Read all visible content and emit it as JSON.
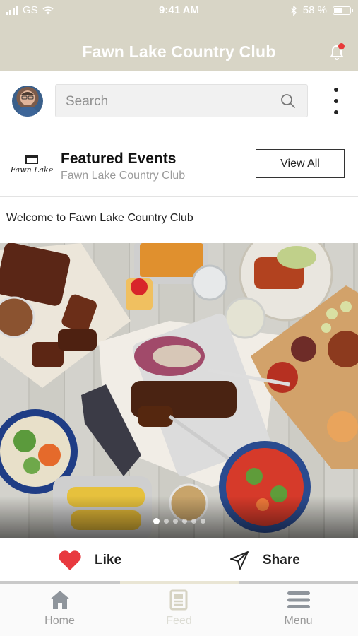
{
  "status_bar": {
    "carrier": "GS",
    "time": "9:41 AM",
    "battery": "58 %",
    "battery_level": 0.58
  },
  "header": {
    "title": "Fawn Lake Country Club",
    "notification_badge": true
  },
  "search": {
    "placeholder": "Search"
  },
  "featured": {
    "title": "Featured Events",
    "subtitle": "Fawn Lake Country Club",
    "view_all_label": "View All",
    "logo_text": "Fawn Lake"
  },
  "post": {
    "text": "Welcome to Fawn Lake Country Club",
    "carousel_count": 6,
    "carousel_active": 0
  },
  "actions": {
    "like_label": "Like",
    "share_label": "Share"
  },
  "tabs": [
    {
      "label": "Home",
      "icon": "home-icon"
    },
    {
      "label": "Feed",
      "icon": "feed-icon"
    },
    {
      "label": "Menu",
      "icon": "menu-icon"
    }
  ],
  "colors": {
    "header_bg": "#d8d5c6",
    "heart": "#e8393f",
    "badge": "#e83a3a"
  }
}
